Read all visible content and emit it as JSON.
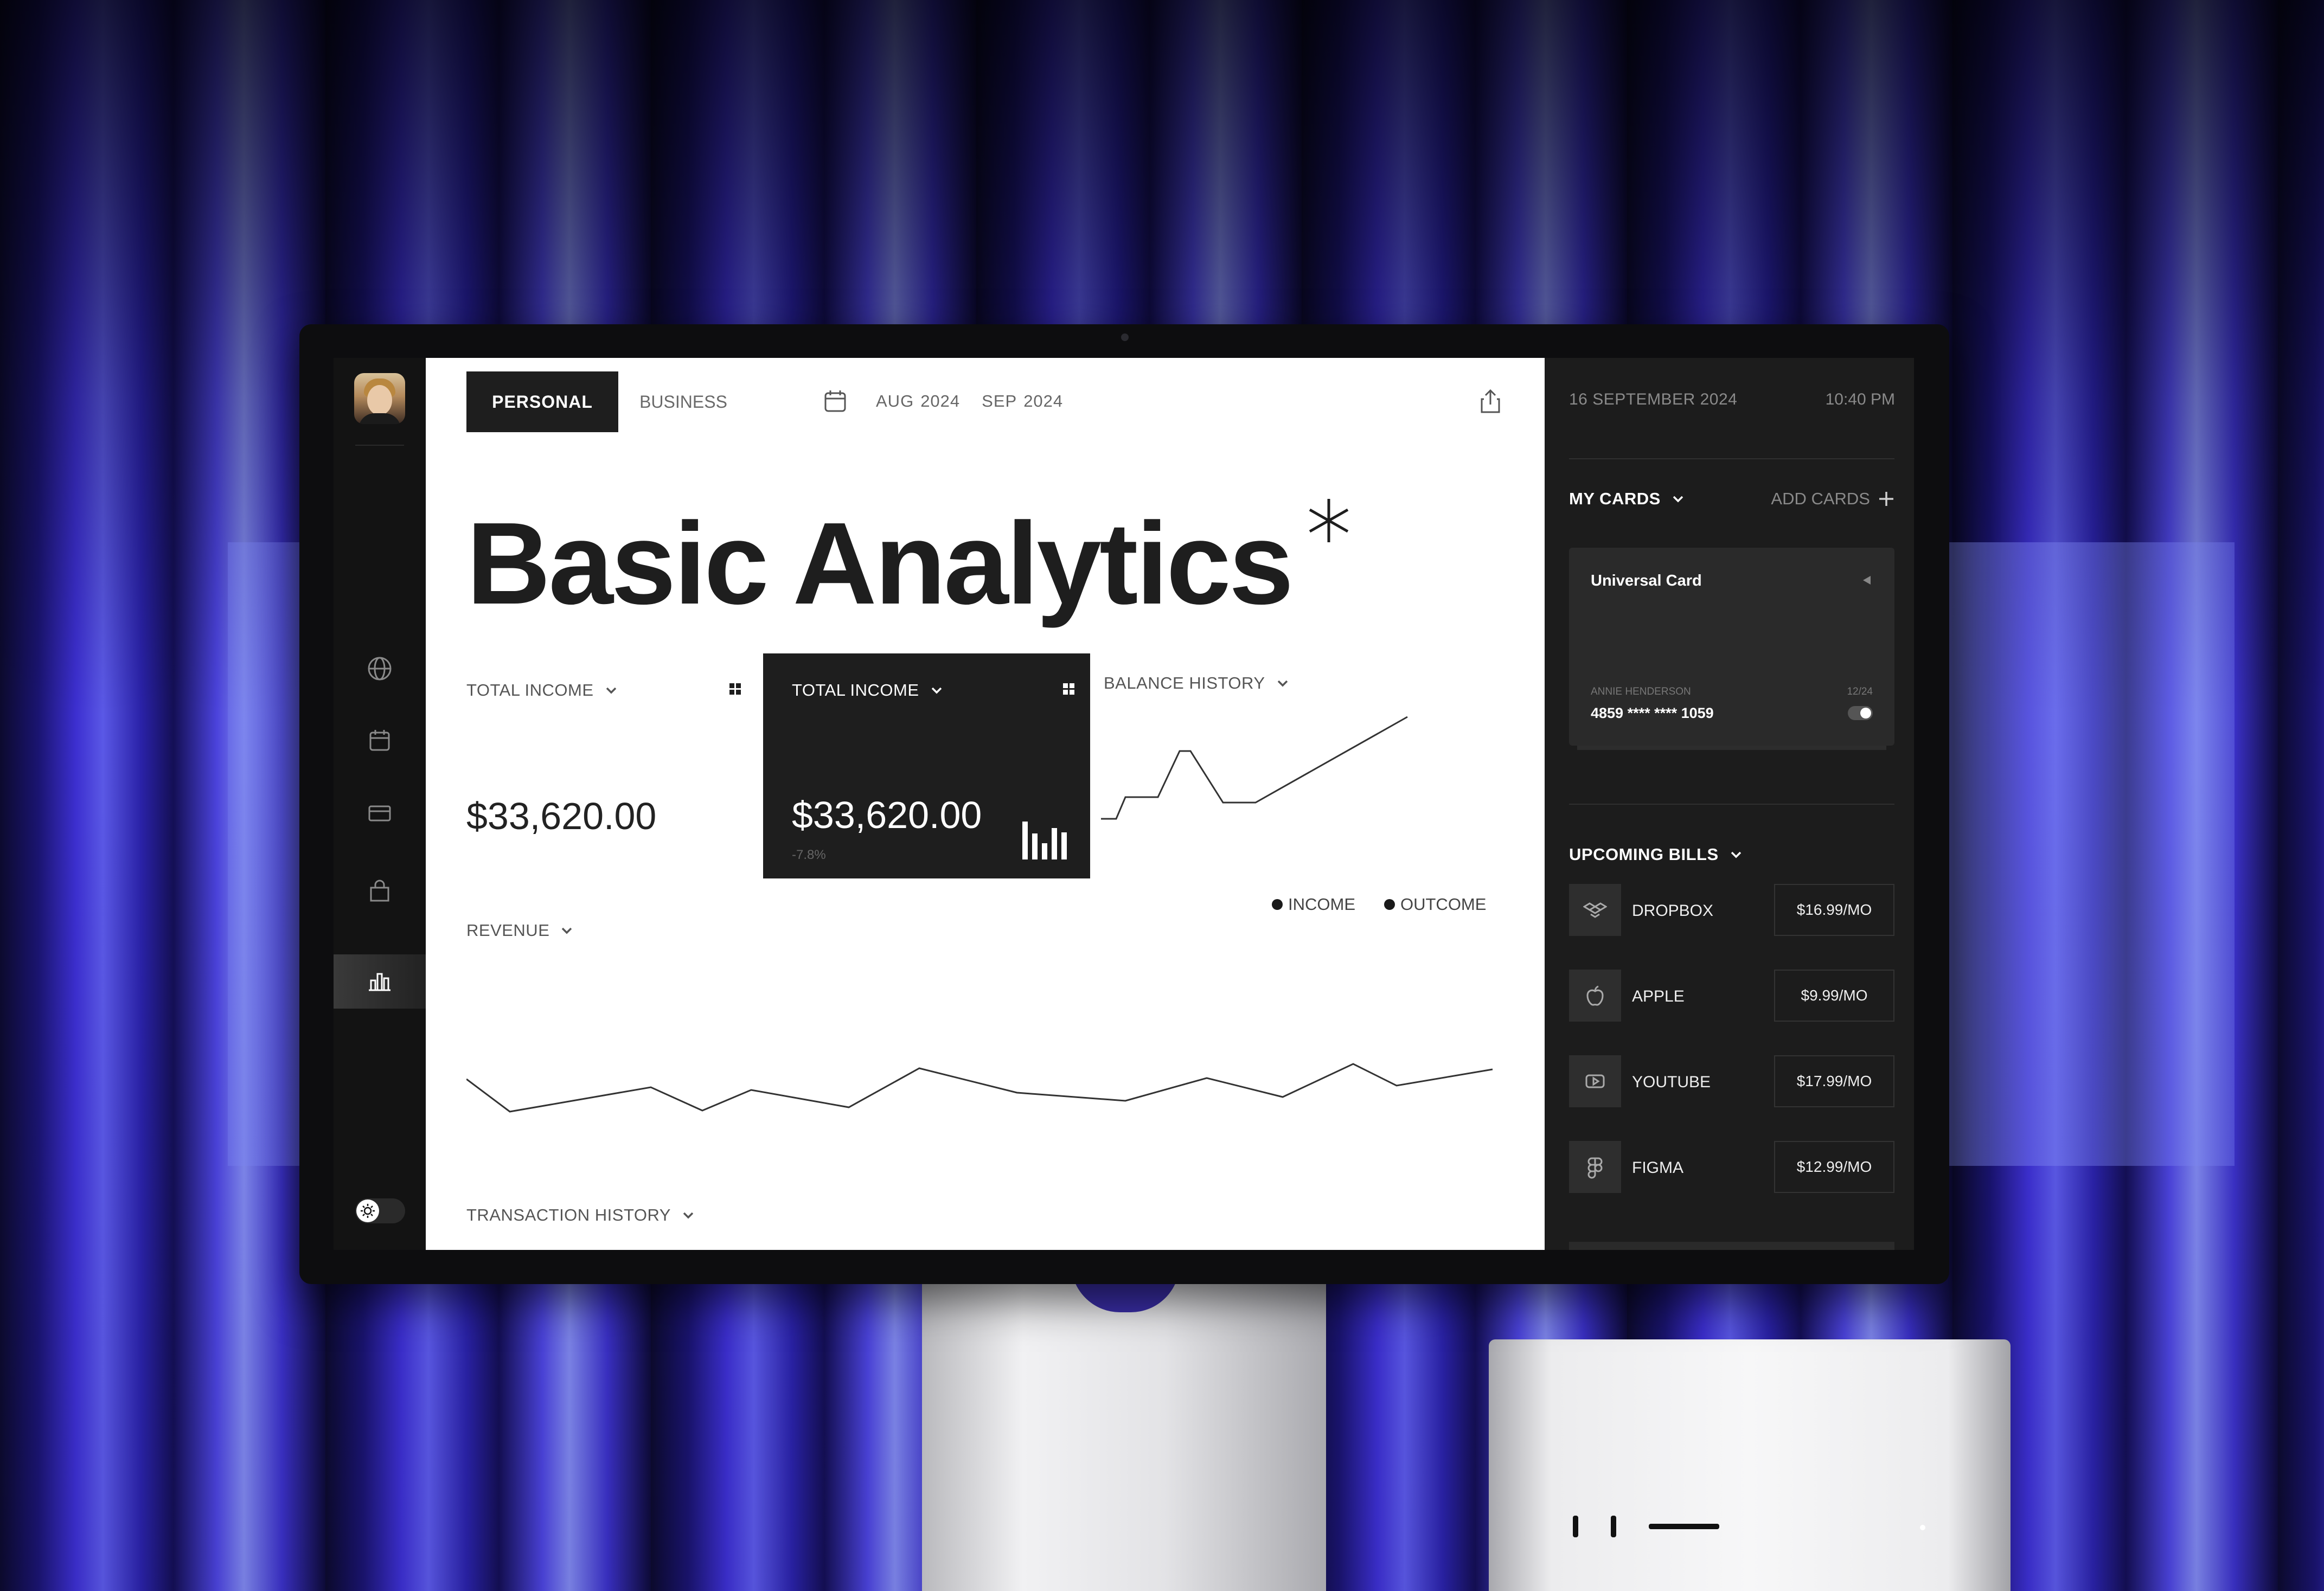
{
  "tabs": {
    "personal": "PERSONAL",
    "business": "BUSINESS"
  },
  "date_range": {
    "from_month": "AUG",
    "from_year": "2024",
    "to_month": "SEP",
    "to_year": "2024"
  },
  "page_title": "Basic Analytics",
  "cards": {
    "income_light": {
      "label": "TOTAL INCOME",
      "value": "$33,620.00"
    },
    "income_dark": {
      "label": "TOTAL INCOME",
      "value": "$33,620.00",
      "change": "-7.8%"
    },
    "balance_history": {
      "label": "BALANCE HISTORY"
    }
  },
  "legend": {
    "income": "INCOME",
    "outcome": "OUTCOME"
  },
  "revenue": {
    "label": "REVENUE"
  },
  "transactions": {
    "label": "TRANSACTION HISTORY"
  },
  "sidebar": {
    "items": [
      {
        "icon": "globe-icon",
        "active": false
      },
      {
        "icon": "calendar-icon",
        "active": false
      },
      {
        "icon": "credit-card-icon",
        "active": false
      },
      {
        "icon": "shopping-bag-icon",
        "active": false
      },
      {
        "icon": "bar-chart-icon",
        "active": true
      }
    ],
    "theme_toggle_icon": "sun-icon"
  },
  "right_panel": {
    "date": "16 SEPTEMBER 2024",
    "time": "10:40 PM",
    "my_cards": "MY CARDS",
    "add_cards": "ADD CARDS",
    "card": {
      "name": "Universal Card",
      "holder": "ANNIE HENDERSON",
      "expiry": "12/24",
      "number": "4859 **** **** 1059"
    },
    "upcoming_bills": "UPCOMING BILLS",
    "bills": [
      {
        "name": "DROPBOX",
        "price": "$16.99/MO",
        "icon": "dropbox-icon"
      },
      {
        "name": "APPLE",
        "price": "$9.99/MO",
        "icon": "apple-icon"
      },
      {
        "name": "YOUTUBE",
        "price": "$17.99/MO",
        "icon": "youtube-icon"
      },
      {
        "name": "FIGMA",
        "price": "$12.99/MO",
        "icon": "figma-icon"
      }
    ]
  },
  "colors": {
    "main_bg": "#ffffff",
    "dark_panel": "#1c1c1c",
    "accent_dark": "#1e1e1e",
    "background_purple": "#4b43dc"
  }
}
